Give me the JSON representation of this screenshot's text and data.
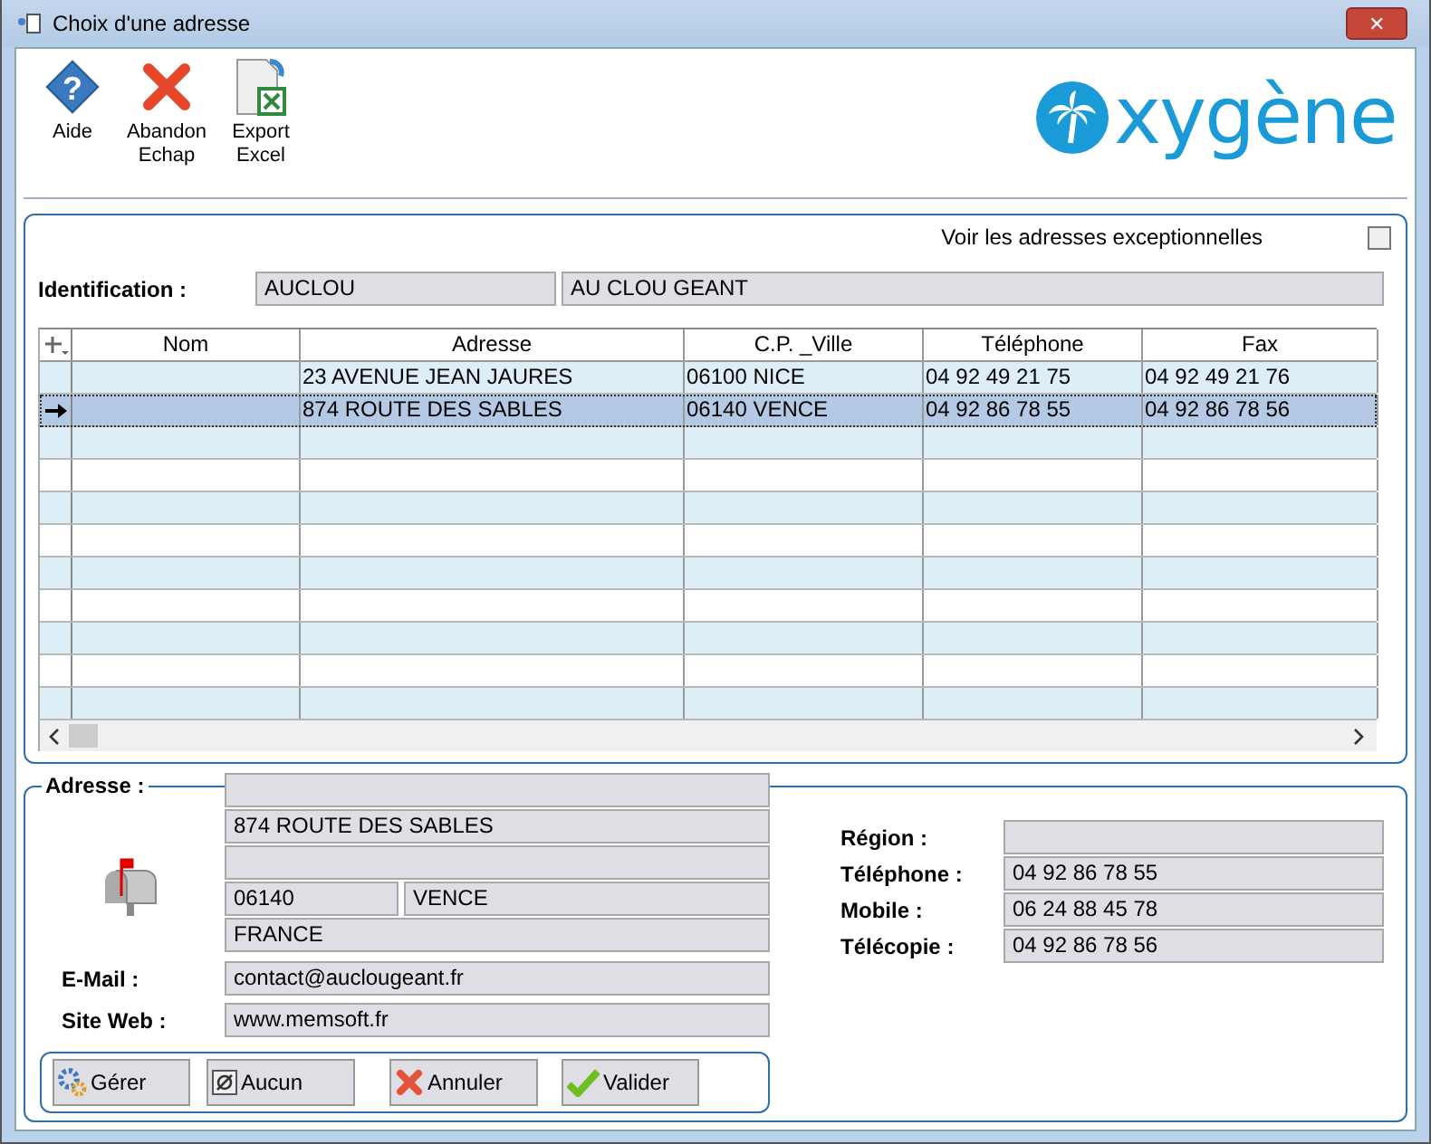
{
  "window": {
    "title": "Choix d'une adresse",
    "close_label": "✕"
  },
  "toolbar": [
    {
      "kind": "help",
      "label": "Aide",
      "glyph": "?"
    },
    {
      "kind": "cancel",
      "label": "Abandon\nEchap"
    },
    {
      "kind": "excel",
      "label": "Export\nExcel"
    }
  ],
  "logo": {
    "text": "xygène"
  },
  "options": {
    "label": "Voir les adresses exceptionnelles",
    "checked": false
  },
  "identification": {
    "label": "Identification :",
    "code": "AUCLOU",
    "name": "AU CLOU GEANT"
  },
  "table": {
    "columns": [
      "Nom",
      "Adresse",
      "C.P. _Ville",
      "Téléphone",
      "Fax"
    ],
    "rows": [
      {
        "selected": false,
        "cells": [
          "",
          "23 AVENUE JEAN JAURES",
          "06100 NICE",
          "04 92 49 21 75",
          "04 92 49 21 76"
        ]
      },
      {
        "selected": true,
        "cells": [
          "",
          "874 ROUTE DES SABLES",
          "06140 VENCE",
          "04 92 86 78 55",
          "04 92 86 78 56"
        ]
      }
    ]
  },
  "address": {
    "label": "Adresse :",
    "line2": "874 ROUTE DES SABLES",
    "postcode": "06140",
    "city": "VENCE",
    "country": "FRANCE",
    "email_label": "E-Mail :",
    "email": "contact@auclougeant.fr",
    "web_label": "Site Web :",
    "web": "www.memsoft.fr"
  },
  "contact": [
    {
      "label": "Région :"
    },
    {
      "label": "Téléphone :",
      "value": "04 92 86 78 55"
    },
    {
      "label": "Mobile :",
      "value": "06 24 88 45 78"
    },
    {
      "label": "Télécopie :",
      "value": "04 92 86 78 56"
    }
  ],
  "buttons": [
    {
      "kind": "manage",
      "label": "Gérer"
    },
    {
      "kind": "none",
      "label": "Aucun"
    },
    {
      "kind": "cancel",
      "label": "Annuler"
    },
    {
      "kind": "ok",
      "label": "Valider"
    }
  ]
}
